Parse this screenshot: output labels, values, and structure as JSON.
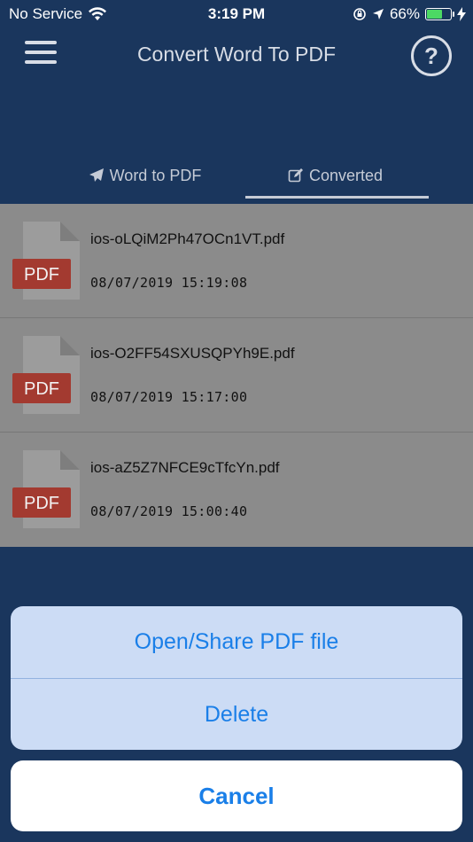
{
  "status_bar": {
    "carrier": "No Service",
    "time": "3:19 PM",
    "battery_percent": "66%",
    "battery_level": 0.66
  },
  "nav": {
    "title": "Convert Word To PDF",
    "help_symbol": "?"
  },
  "tabs": [
    {
      "label": "Word to PDF",
      "icon": "paper-plane-icon",
      "active": false
    },
    {
      "label": "Converted",
      "icon": "edit-icon",
      "active": true
    }
  ],
  "files": [
    {
      "name": "ios-oLQiM2Ph47OCn1VT.pdf",
      "date": "08/07/2019 15:19:08",
      "badge": "PDF"
    },
    {
      "name": "ios-O2FF54SXUSQPYh9E.pdf",
      "date": "08/07/2019 15:17:00",
      "badge": "PDF"
    },
    {
      "name": "ios-aZ5Z7NFCE9cTfcYn.pdf",
      "date": "08/07/2019 15:00:40",
      "badge": "PDF"
    }
  ],
  "action_sheet": {
    "open_share_label": "Open/Share PDF file",
    "delete_label": "Delete",
    "cancel_label": "Cancel"
  },
  "colors": {
    "background": "#1a365d",
    "accent": "#1a7fe8",
    "pdf_badge": "#c0392b",
    "battery": "#4cd964"
  }
}
